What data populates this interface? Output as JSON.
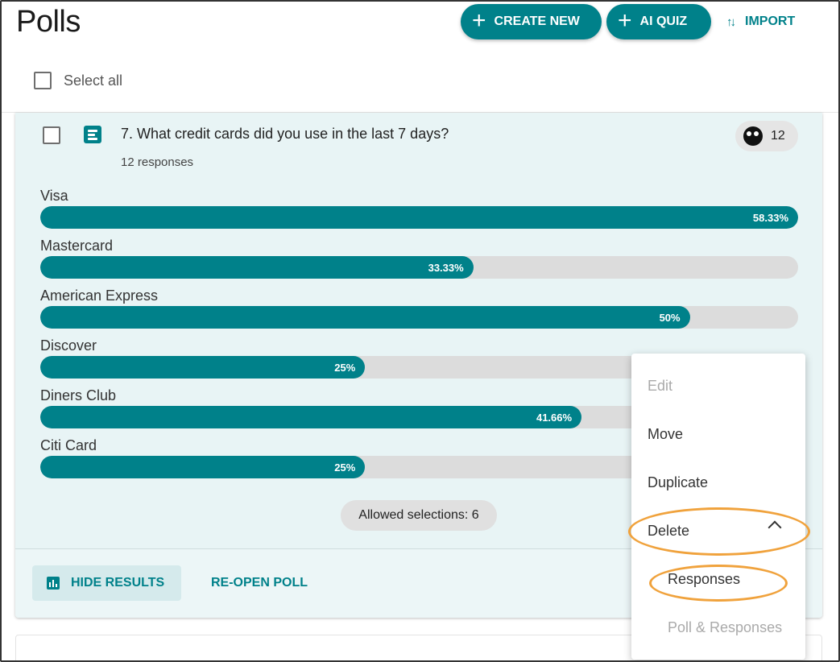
{
  "header": {
    "title": "Polls",
    "create_new_label": "CREATE NEW",
    "ai_quiz_label": "AI QUIZ",
    "import_label": "IMPORT",
    "import_arrows": "↑↓",
    "select_all_label": "Select all"
  },
  "poll": {
    "title": "7. What credit cards did you use in the last 7 days?",
    "responses_text": "12 responses",
    "response_count": "12",
    "options": [
      {
        "name": "Visa",
        "percent_label": "58.33%",
        "percent": 58.33
      },
      {
        "name": "Mastercard",
        "percent_label": "33.33%",
        "percent": 33.33
      },
      {
        "name": "American Express",
        "percent_label": "50%",
        "percent": 50
      },
      {
        "name": "Discover",
        "percent_label": "25%",
        "percent": 25
      },
      {
        "name": "Diners Club",
        "percent_label": "41.66%",
        "percent": 41.66
      },
      {
        "name": "Citi Card",
        "percent_label": "25%",
        "percent": 25
      }
    ],
    "allowed_selections": "Allowed selections: 6",
    "hide_results_label": "HIDE RESULTS",
    "reopen_label": "RE-OPEN POLL"
  },
  "menu": {
    "edit": "Edit",
    "move": "Move",
    "duplicate": "Duplicate",
    "delete": "Delete",
    "responses": "Responses",
    "poll_and_responses": "Poll & Responses"
  },
  "colors": {
    "accent": "#00818a",
    "bar_track": "#dcdcdc",
    "card_bg": "#e8f4f5",
    "highlight": "#f0a23c"
  }
}
